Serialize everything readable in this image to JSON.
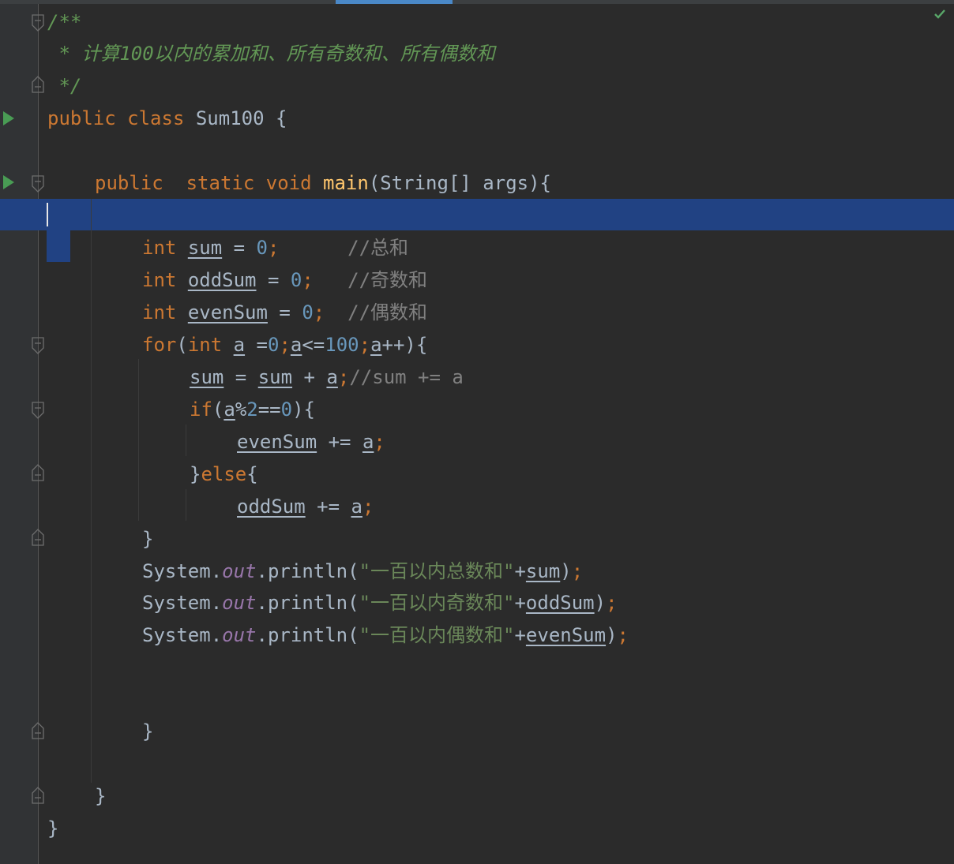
{
  "editor": {
    "language": "Java",
    "lines": {
      "l1": {
        "text": "/**"
      },
      "l2": {
        "text": " * 计算100以内的累加和、所有奇数和、所有偶数和"
      },
      "l3": {
        "text": " */"
      },
      "l4": {
        "kw1": "public",
        "kw2": "class",
        "name": "Sum100",
        "brace": "{"
      },
      "l6": {
        "kw1": "public",
        "kw2": "static",
        "kw3": "void",
        "fn": "main",
        "rest": "(String[] args){"
      },
      "l8": {
        "kw": "int",
        "var": "sum",
        "eq": " = ",
        "num": "0",
        "semi": ";",
        "comment": "//总和"
      },
      "l9": {
        "kw": "int",
        "var": "oddSum",
        "eq": " = ",
        "num": "0",
        "semi": ";",
        "comment": "//奇数和"
      },
      "l10": {
        "kw": "int",
        "var": "evenSum",
        "eq": " = ",
        "num": "0",
        "semi": ";",
        "comment": "//偶数和"
      },
      "l11": {
        "kw1": "for",
        "p1": "(",
        "kw2": "int",
        "v1": "a",
        "p2": " =",
        "n1": "0",
        "s1": ";",
        "v2": "a",
        "p3": "<=",
        "n2": "100",
        "s2": ";",
        "v3": "a",
        "p4": "++){"
      },
      "l12": {
        "v1": "sum",
        "p1": " = ",
        "v2": "sum",
        "p2": " + ",
        "v3": "a",
        "semi": ";",
        "comment": "//sum += a"
      },
      "l13": {
        "kw": "if",
        "p1": "(",
        "v1": "a",
        "p2": "%",
        "n1": "2",
        "p3": "==",
        "n2": "0",
        "p4": "){"
      },
      "l14": {
        "v1": "evenSum",
        "p1": " += ",
        "v2": "a",
        "semi": ";"
      },
      "l15": {
        "p1": "}",
        "kw": "else",
        "p2": "{"
      },
      "l16": {
        "v1": "oddSum",
        "p1": " += ",
        "v2": "a",
        "semi": ";"
      },
      "l17": {
        "text": "}"
      },
      "l18": {
        "cls": "System",
        "dot1": ".",
        "fld": "out",
        "call": ".println(",
        "str": "\"一百以内总数和\"",
        "plus": "+",
        "var": "sum",
        "close": ")",
        "semi": ";"
      },
      "l19": {
        "cls": "System",
        "dot1": ".",
        "fld": "out",
        "call": ".println(",
        "str": "\"一百以内奇数和\"",
        "plus": "+",
        "var": "oddSum",
        "close": ")",
        "semi": ";"
      },
      "l20": {
        "cls": "System",
        "dot1": ".",
        "fld": "out",
        "call": ".println(",
        "str": "\"一百以内偶数和\"",
        "plus": "+",
        "var": "evenSum",
        "close": ")",
        "semi": ";"
      },
      "l23": {
        "text": "}"
      },
      "l25": {
        "text": "}"
      },
      "l26": {
        "text": "}"
      }
    }
  },
  "icons": {
    "run": "run-gutter-icon",
    "fold": "fold-marker-icon",
    "status": "inspection-ok-check-icon"
  },
  "colors": {
    "background": "#2b2b2b",
    "gutter": "#313335",
    "keyword": "#cc7832",
    "number": "#6897bb",
    "string": "#6a8759",
    "comment": "#808080",
    "doc_comment": "#629755",
    "function": "#ffc66d",
    "static_field": "#9876aa",
    "selection": "#214283",
    "run_icon": "#499c54",
    "check": "#59a869"
  }
}
